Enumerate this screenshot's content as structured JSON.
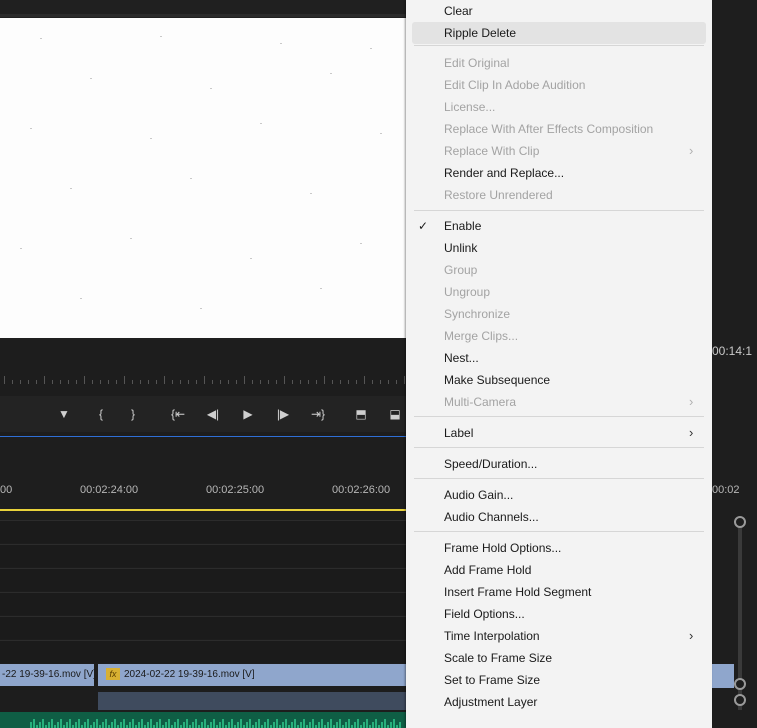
{
  "timeline": {
    "timecodes": [
      "00",
      "00:02:24:00",
      "00:02:25:00",
      "00:02:26:00",
      "00:02"
    ],
    "monitor_timecode": "00:14:1",
    "clips": {
      "clip1_label": "-22 19-39-16.mov [V]",
      "clip2_label": "2024-02-22 19-39-16.mov [V]",
      "fx_badge": "fx"
    }
  },
  "transport": {
    "buttons": [
      "marker-icon",
      "mark-in-icon",
      "mark-out-icon",
      "go-to-in-icon",
      "step-back-icon",
      "play-icon",
      "step-forward-icon",
      "go-to-out-icon",
      "lift-icon",
      "extract-icon"
    ]
  },
  "menu": {
    "items": [
      {
        "label": "Clear",
        "enabled": true
      },
      {
        "label": "Ripple Delete",
        "enabled": true,
        "highlighted": true
      },
      {
        "label": "Edit Original",
        "enabled": false
      },
      {
        "label": "Edit Clip In Adobe Audition",
        "enabled": false
      },
      {
        "label": "License...",
        "enabled": false
      },
      {
        "label": "Replace With After Effects Composition",
        "enabled": false
      },
      {
        "label": "Replace With Clip",
        "enabled": false,
        "submenu": true
      },
      {
        "label": "Render and Replace...",
        "enabled": true
      },
      {
        "label": "Restore Unrendered",
        "enabled": false
      },
      {
        "label": "Enable",
        "enabled": true,
        "checked": true
      },
      {
        "label": "Unlink",
        "enabled": true
      },
      {
        "label": "Group",
        "enabled": false
      },
      {
        "label": "Ungroup",
        "enabled": false
      },
      {
        "label": "Synchronize",
        "enabled": false
      },
      {
        "label": "Merge Clips...",
        "enabled": false
      },
      {
        "label": "Nest...",
        "enabled": true
      },
      {
        "label": "Make Subsequence",
        "enabled": true
      },
      {
        "label": "Multi-Camera",
        "enabled": false,
        "submenu": true
      },
      {
        "label": "Label",
        "enabled": true,
        "submenu": true
      },
      {
        "label": "Speed/Duration...",
        "enabled": true
      },
      {
        "label": "Audio Gain...",
        "enabled": true
      },
      {
        "label": "Audio Channels...",
        "enabled": true
      },
      {
        "label": "Frame Hold Options...",
        "enabled": true
      },
      {
        "label": "Add Frame Hold",
        "enabled": true
      },
      {
        "label": "Insert Frame Hold Segment",
        "enabled": true
      },
      {
        "label": "Field Options...",
        "enabled": true
      },
      {
        "label": "Time Interpolation",
        "enabled": true,
        "submenu": true
      },
      {
        "label": "Scale to Frame Size",
        "enabled": true
      },
      {
        "label": "Set to Frame Size",
        "enabled": true
      },
      {
        "label": "Adjustment Layer",
        "enabled": true
      }
    ],
    "checkmark_glyph": "✓",
    "submenu_glyph": "›"
  },
  "colors": {
    "menu_bg": "#f3f3f3",
    "disabled_text": "#a3a3a3",
    "playhead_bar": "#e8d23b",
    "clip_video": "#8fa6cc",
    "audio_wave": "#27b07c"
  }
}
